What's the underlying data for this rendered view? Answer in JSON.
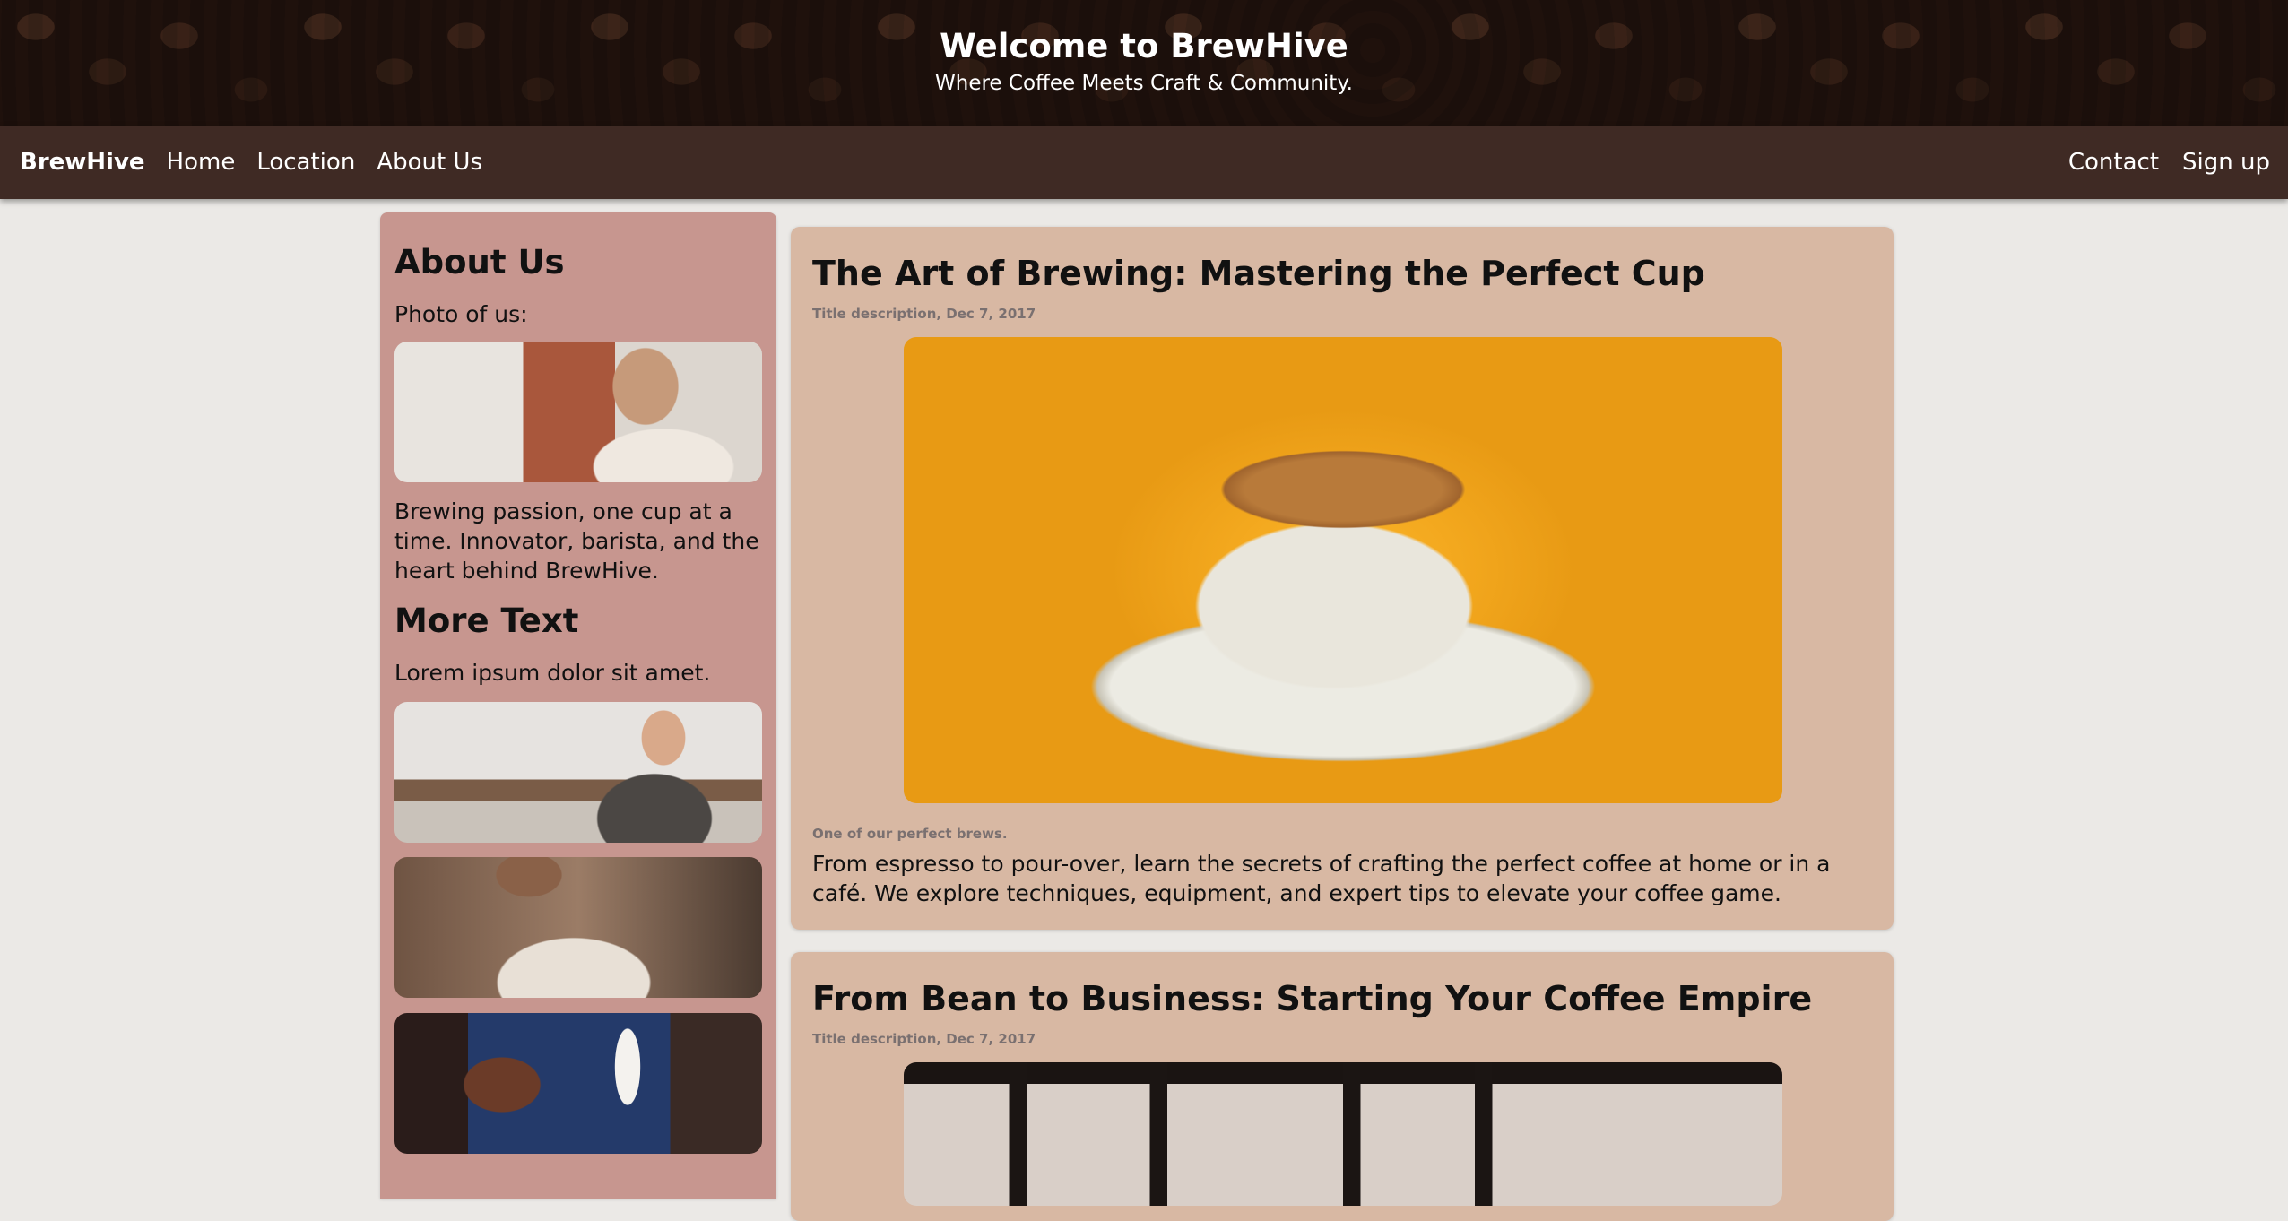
{
  "header": {
    "title": "Welcome to BrewHive",
    "subtitle": "Where Coffee Meets Craft & Community."
  },
  "nav": {
    "brand": "BrewHive",
    "left_links": [
      "Home",
      "Location",
      "About Us"
    ],
    "right_links": [
      "Contact",
      "Sign up"
    ]
  },
  "sidebar": {
    "about_heading": "About Us",
    "photo_label": "Photo of us:",
    "about_text": "Brewing passion, one cup at a time. Innovator, barista, and the heart behind BrewHive.",
    "more_heading": "More Text",
    "more_text": "Lorem ipsum dolor sit amet."
  },
  "posts": [
    {
      "title": "The Art of Brewing: Mastering the Perfect Cup",
      "meta": "Title description, Dec 7, 2017",
      "caption": "One of our perfect brews.",
      "body": "From espresso to pour-over, learn the secrets of crafting the perfect coffee at home or in a café. We explore techniques, equipment, and expert tips to elevate your coffee game."
    },
    {
      "title": "From Bean to Business: Starting Your Coffee Empire",
      "meta": "Title description, Dec 7, 2017"
    }
  ],
  "colors": {
    "navbar": "#3f2a24",
    "sidebar": "#c7968f",
    "card": "#d8b8a3",
    "page_bg": "#ebe9e6"
  }
}
